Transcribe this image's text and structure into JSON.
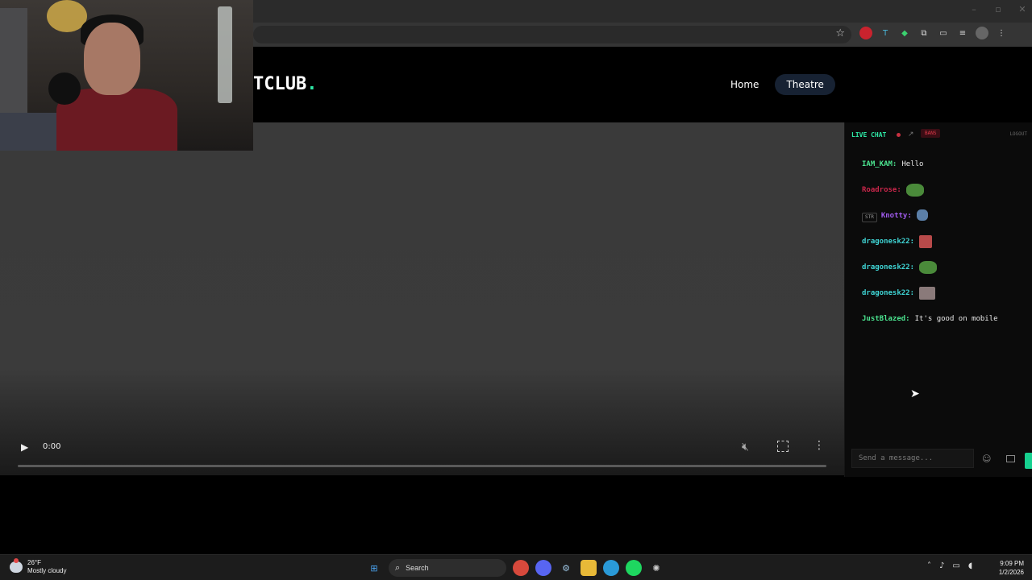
{
  "site": {
    "logo_text": "TCLUB",
    "logo_dot": ".",
    "nav": {
      "home": "Home",
      "theatre": "Theatre"
    }
  },
  "video": {
    "time": "0:00",
    "progress": 0
  },
  "chat": {
    "live_chat_label": "LIVE CHAT",
    "bans_label": "BANS",
    "logout_label": "LOGOUT",
    "input_placeholder": "Send a message...",
    "messages": [
      {
        "user": "IAM_KAM:",
        "text": "Hello",
        "color": "#4be38f"
      },
      {
        "user": "Roadrose:",
        "emote": "pepe",
        "color": "#c8264a"
      },
      {
        "badge": "STR",
        "user": "Knotty:",
        "emote": "pepe-small",
        "color": "#a25cf0"
      },
      {
        "user": "dragonesk22:",
        "emote": "red-emote",
        "color": "#3fd4d4"
      },
      {
        "user": "dragonesk22:",
        "emote": "pepe",
        "color": "#3fd4d4"
      },
      {
        "user": "dragonesk22:",
        "emote": "photo",
        "color": "#3fd4d4"
      },
      {
        "user": "JustBlazed:",
        "text": "It's good on mobile",
        "color": "#4be38f"
      }
    ]
  },
  "taskbar": {
    "weather_temp": "26°F",
    "weather_desc": "Mostly cloudy",
    "search_label": "Search",
    "time": "9:09 PM",
    "date": "1/2/2026"
  },
  "colors": {
    "accent": "#2ee8a6",
    "nav_pill": "#172233",
    "send_button": "#16d08f"
  }
}
